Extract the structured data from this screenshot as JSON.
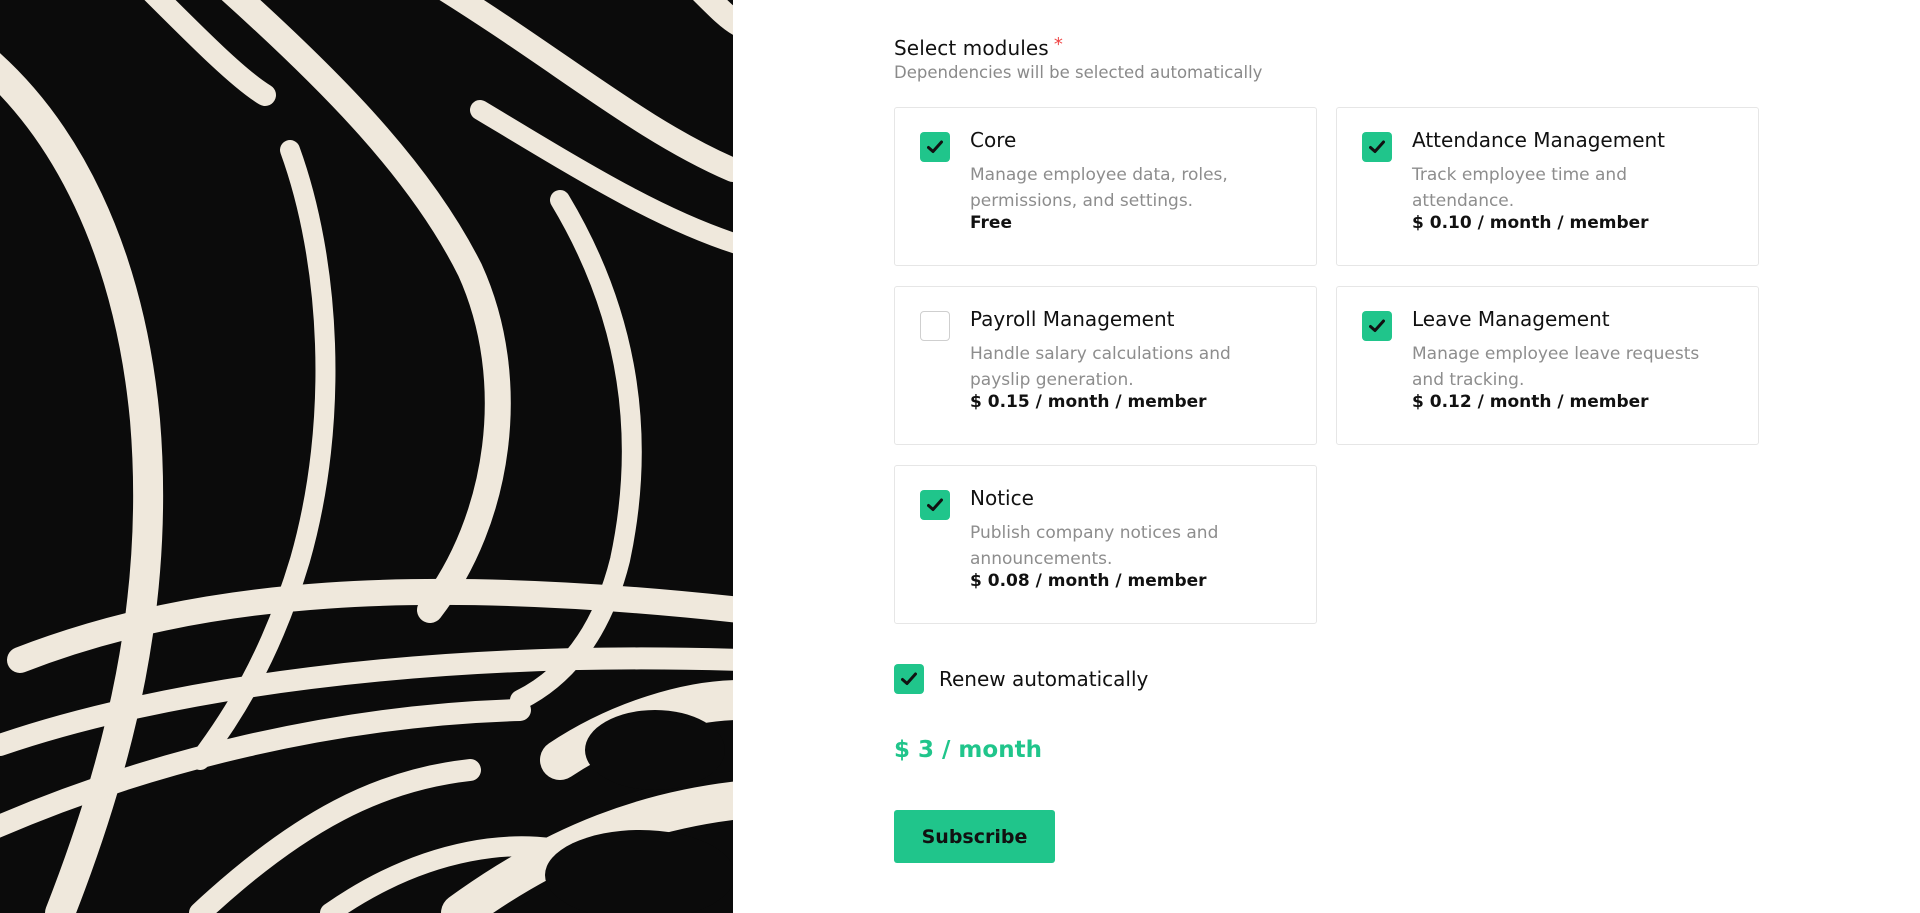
{
  "colors": {
    "accent": "#20c58b",
    "required": "#ef4444",
    "muted_text": "#8d8d8d",
    "border": "#e6e6e6"
  },
  "art": {
    "icon": "abstract-swirl-artwork"
  },
  "form": {
    "section_title": "Select modules",
    "required_marker": "*",
    "hint": "Dependencies will be selected automatically",
    "modules": [
      {
        "name": "Core",
        "description": "Manage employee data, roles, permissions, and settings.",
        "price": "Free",
        "checked": true
      },
      {
        "name": "Attendance Management",
        "description": "Track employee time and attendance.",
        "price": "$ 0.10 / month / member",
        "checked": true
      },
      {
        "name": "Payroll Management",
        "description": "Handle salary calculations and payslip generation.",
        "price": "$ 0.15 / month / member",
        "checked": false
      },
      {
        "name": "Leave Management",
        "description": "Manage employee leave requests and tracking.",
        "price": "$ 0.12 / month / member",
        "checked": true
      },
      {
        "name": "Notice",
        "description": "Publish company notices and announcements.",
        "price": "$ 0.08 / month / member",
        "checked": true
      }
    ],
    "renew": {
      "label": "Renew automatically",
      "checked": true
    },
    "total": "$ 3 / month",
    "subscribe_label": "Subscribe"
  }
}
